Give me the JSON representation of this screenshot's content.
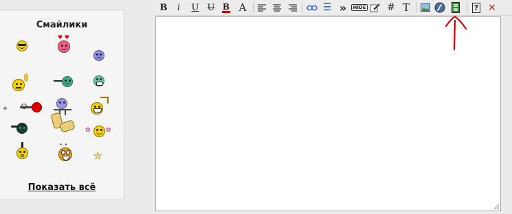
{
  "smilies": {
    "title": "Смайлики",
    "show_all": "Показать всё"
  },
  "toolbar": {
    "bold": "B",
    "italic": "i",
    "underline": "U",
    "strike": "U",
    "font_size": "A",
    "list": "☰",
    "quote": "»",
    "hide": "HIDE",
    "code": "#",
    "plain": "T",
    "help": "?",
    "close": "×"
  },
  "colors": {
    "accent": "#cc0000",
    "annotation": "#e00000"
  }
}
